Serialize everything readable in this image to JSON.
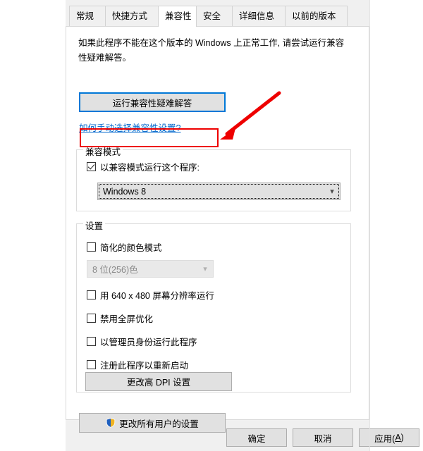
{
  "dialog": {
    "tabs": [
      {
        "label": "常规",
        "active": false
      },
      {
        "label": "快捷方式",
        "active": false
      },
      {
        "label": "兼容性",
        "active": true
      },
      {
        "label": "安全",
        "active": false
      },
      {
        "label": "详细信息",
        "active": false
      },
      {
        "label": "以前的版本",
        "active": false
      }
    ],
    "description": "如果此程序不能在这个版本的 Windows 上正常工作, 请尝试运行兼容性疑难解答。",
    "troubleshoot_button": "运行兼容性疑难解答",
    "howto_link": "如何手动选择兼容性设置?",
    "compat_group": {
      "legend": "兼容模式",
      "checkbox_label": "以兼容模式运行这个程序:",
      "checkbox_checked": "true",
      "os_value": "Windows 8",
      "os_arrow_icon": "chevron-down-icon"
    },
    "settings_group": {
      "legend": "设置",
      "color_mode": {
        "label": "简化的颜色模式",
        "checked": "false",
        "value": "8 位(256)色",
        "arrow_icon": "chevron-down-icon",
        "disabled": "true"
      },
      "options": [
        {
          "label": "用 640 x 480 屏幕分辨率运行",
          "checked": "false"
        },
        {
          "label": "禁用全屏优化",
          "checked": "false"
        },
        {
          "label": "以管理员身份运行此程序",
          "checked": "false"
        },
        {
          "label": "注册此程序以重新启动",
          "checked": "false"
        }
      ],
      "dpi_button": "更改高 DPI 设置"
    },
    "all_users_button": {
      "label": "更改所有用户的设置",
      "icon": "uac-shield-icon"
    },
    "footer_buttons": [
      {
        "label": "确定",
        "accel": ""
      },
      {
        "label": "取消",
        "accel": ""
      },
      {
        "label": "应用(",
        "accel": "A",
        "suffix": ")"
      }
    ]
  },
  "annotations": {
    "highlight_rect": "checkbox-highlight",
    "arrow": "red-arrow-pointing-to-checkbox",
    "color": "#ee0000"
  }
}
